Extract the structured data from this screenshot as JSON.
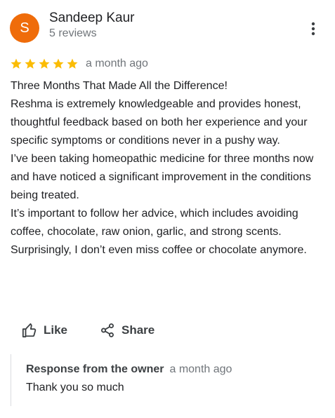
{
  "reviewer": {
    "initial": "S",
    "name": "Sandeep Kaur",
    "review_count": "5 reviews",
    "avatar_color": "#ef6c0a"
  },
  "menu": {
    "icon": "more-vert-icon"
  },
  "rating": {
    "stars": 5,
    "max_stars": 5,
    "star_color": "#fbbc04",
    "date": "a month ago"
  },
  "review": {
    "paragraphs": [
      "Three Months That Made All the Difference!",
      "Reshma is extremely knowledgeable and provides honest, thoughtful feedback based on both her experience and your specific symptoms or conditions never in a pushy way.",
      "I’ve been taking homeopathic medicine for three months now and have noticed a significant improvement in the conditions being treated.",
      "It’s important to follow her advice, which includes avoiding coffee, chocolate, raw onion, garlic, and strong scents. Surprisingly, I don’t even miss coffee or chocolate anymore."
    ]
  },
  "actions": {
    "like_label": "Like",
    "like_icon": "thumbs-up-icon",
    "share_label": "Share",
    "share_icon": "share-icon"
  },
  "owner_response": {
    "title": "Response from the owner",
    "date": "a month ago",
    "text": "Thank you so much"
  }
}
